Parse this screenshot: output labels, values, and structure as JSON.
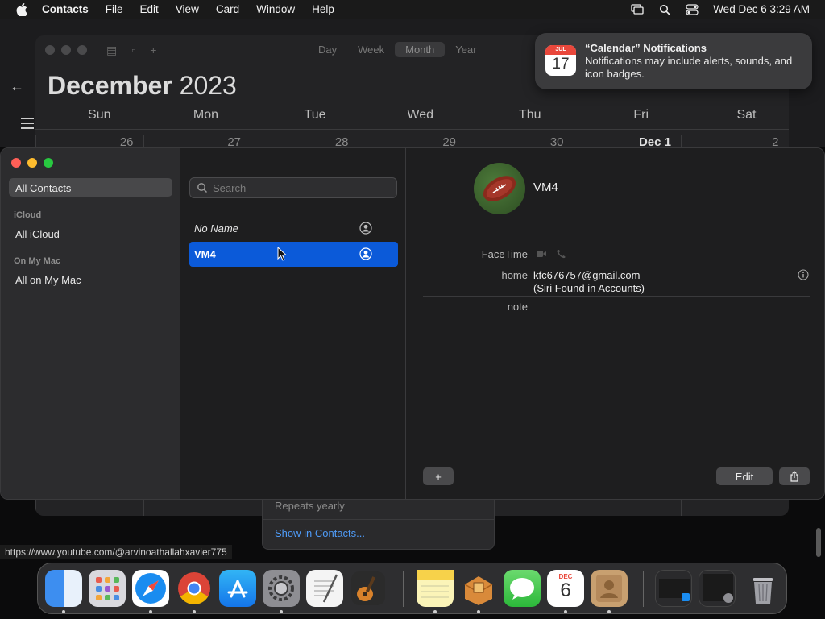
{
  "menubar": {
    "app_name": "Contacts",
    "menus": [
      "File",
      "Edit",
      "View",
      "Card",
      "Window",
      "Help"
    ],
    "clock": "Wed Dec 6  3:29 AM",
    "icons": [
      "screen-mirroring-icon",
      "spotlight-search-icon",
      "control-center-icon"
    ]
  },
  "calendar": {
    "month": "December",
    "year": "2023",
    "views": [
      "Day",
      "Week",
      "Month",
      "Year"
    ],
    "active_view": "Month",
    "weekdays": [
      "Sun",
      "Mon",
      "Tue",
      "Wed",
      "Thu",
      "Fri",
      "Sat"
    ],
    "dates": [
      "26",
      "27",
      "28",
      "29",
      "30",
      "Dec 1",
      "2"
    ]
  },
  "notification": {
    "title": "“Calendar” Notifications",
    "body": "Notifications may include alerts, sounds, and icon badges.",
    "icon_month": "JUL",
    "icon_day": "17"
  },
  "contacts": {
    "sidebar": {
      "all_contacts": "All Contacts",
      "icloud_header": "iCloud",
      "all_icloud": "All iCloud",
      "onmymac_header": "On My Mac",
      "all_on_my_mac": "All on My Mac"
    },
    "search_placeholder": "Search",
    "list": [
      {
        "name": "No Name",
        "selected": false
      },
      {
        "name": "VM4",
        "selected": true
      }
    ],
    "detail": {
      "name": "VM4",
      "facetime_label": "FaceTime",
      "home_label": "home",
      "email": "kfc676757@gmail.com",
      "email_note": "(Siri Found in Accounts)",
      "note_label": "note",
      "add_label": "+",
      "edit_label": "Edit"
    }
  },
  "popover": {
    "repeats": "Repeats yearly",
    "show_link": "Show in Contacts..."
  },
  "status_url": "https://www.youtube.com/@arvinoathallahxavier775",
  "dock": {
    "calendar_icon_month": "DEC",
    "calendar_icon_day": "6",
    "apps": [
      "Finder",
      "Launchpad",
      "Safari",
      "Chrome",
      "App Store",
      "System Settings",
      "TextEdit",
      "GarageBand",
      "Notes",
      "Archive Utility",
      "Messages",
      "Calendar",
      "Contacts"
    ]
  }
}
